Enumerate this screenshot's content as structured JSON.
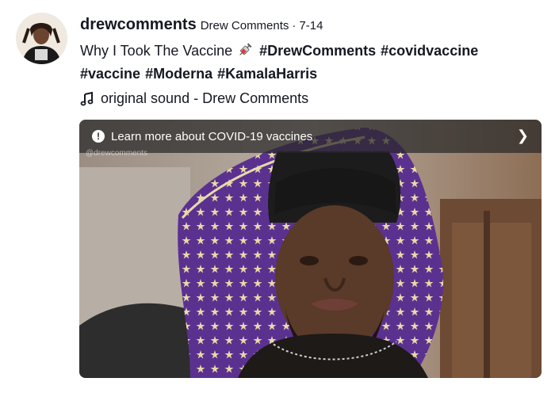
{
  "author": {
    "username": "drewcomments",
    "nickname": "Drew Comments",
    "separator": "·",
    "date": "7-14"
  },
  "caption": {
    "text": "Why I Took The Vaccine",
    "emoji_icon": "syringe-icon",
    "hashtags": [
      "#DrewComments",
      "#covidvaccine",
      "#vaccine",
      "#Moderna",
      "#KamalaHarris"
    ]
  },
  "music": {
    "icon": "music-note-icon",
    "label": "original sound - Drew Comments"
  },
  "video": {
    "banner_text": "Learn more about COVID-19 vaccines",
    "banner_icon": "info-icon",
    "banner_chevron": "chevron-right-icon",
    "watermark": "@drewcomments"
  },
  "colors": {
    "text": "#161823",
    "bandana": "#5b3190",
    "banner_bg": "#282828"
  }
}
